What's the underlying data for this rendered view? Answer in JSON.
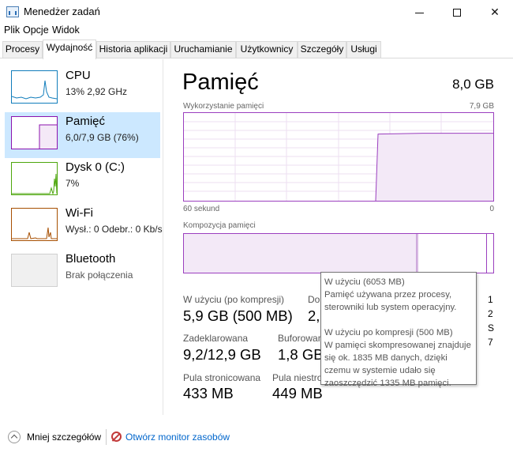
{
  "window": {
    "title": "Menedżer zadań"
  },
  "menu": [
    "Plik",
    "Opcje",
    "Widok"
  ],
  "tabs": [
    "Procesy",
    "Wydajność",
    "Historia aplikacji",
    "Uruchamianie",
    "Użytkownicy",
    "Szczegóły",
    "Usługi"
  ],
  "active_tab": "Wydajność",
  "sidebar": [
    {
      "name": "CPU",
      "sub": "13%  2,92 GHz",
      "color": "#117dbb"
    },
    {
      "name": "Pamięć",
      "sub": "6,0/7,9 GB (76%)",
      "color": "#8b12ae"
    },
    {
      "name": "Dysk 0 (C:)",
      "sub": "7%",
      "color": "#4da60c"
    },
    {
      "name": "Wi-Fi",
      "sub": "Wysł.: 0  Odebr.: 0 Kb/s",
      "color": "#a74f01"
    },
    {
      "name": "Bluetooth",
      "sub": "Brak połączenia",
      "color": "#aaaaaa"
    }
  ],
  "main": {
    "title": "Pamięć",
    "total": "8,0 GB",
    "usage_label": "Wykorzystanie pamięci",
    "usage_max": "7,9 GB",
    "time_left": "60 sekund",
    "time_right": "0",
    "composition_label": "Kompozycja pamięci",
    "accent": "#9b3fbf",
    "usage_level": 0.76
  },
  "stats": {
    "in_use_label": "W użyciu (po kompresji)",
    "in_use_value": "5,9 GB (500 MB)",
    "available_label": "Do",
    "available_value": "2,",
    "committed_label": "Zadeklarowana",
    "committed_value": "9,2/12,9 GB",
    "cached_label": "Buforowan",
    "cached_value": "1,8 GB",
    "paged_label": "Pula stronicowana",
    "paged_value": "433 MB",
    "nonpaged_label": "Pula niestro",
    "nonpaged_value": "449 MB",
    "col3": [
      "1",
      "2",
      "S",
      "7"
    ]
  },
  "tooltip": [
    "W użyciu (6053 MB)",
    "Pamięć używana przez procesy,",
    "sterowniki lub system operacyjny.",
    "",
    "W użyciu po kompresji (500 MB)",
    "W pamięci skompresowanej znajduje",
    "się ok. 1835 MB danych, dzięki",
    "czemu w systemie udało się",
    "zaoszczędzić 1335 MB pamięci."
  ],
  "footer": {
    "less_details": "Mniej szczegółów",
    "open_monitor": "Otwórz monitor zasobów"
  }
}
